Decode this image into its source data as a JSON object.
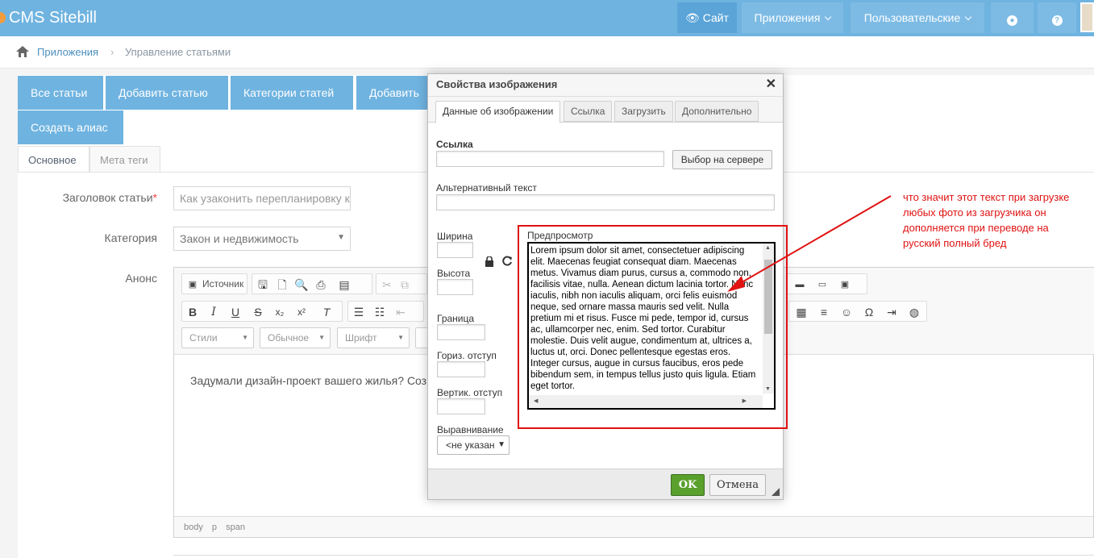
{
  "app": {
    "title": "CMS Sitebill"
  },
  "topbar": {
    "site_label": "Сайт",
    "apps_label": "Приложения",
    "user_label": "Пользовательские",
    "globe_icon": "globe-icon",
    "help_label": "?"
  },
  "breadcrumb": {
    "items": [
      "Приложения",
      "Управление статьями"
    ],
    "separator": "›"
  },
  "actions": [
    "Все статьи",
    "Добавить статью",
    "Категории статей",
    "Добавить",
    "Создать алиас"
  ],
  "form_tabs": [
    "Основное",
    "Мета теги"
  ],
  "form": {
    "title_label": "Заголовок статьи",
    "required_mark": "*",
    "title_value": "Как узаконить перепланировку к",
    "category_label": "Категория",
    "category_value": "Закон и недвижимость",
    "announce_label": "Анонс"
  },
  "editor": {
    "source_label": "Источник",
    "styles_label": "Стили",
    "format_label": "Обычное",
    "font_label": "Шрифт",
    "body_text": "Задумали дизайн-проект вашего жилья? Соз",
    "path": [
      "body",
      "p",
      "span"
    ]
  },
  "dialog": {
    "title": "Свойства изображения",
    "close": "✕",
    "tabs": [
      "Данные об изображении",
      "Ссылка",
      "Загрузить",
      "Дополнительно"
    ],
    "url_label": "Ссылка",
    "browse_button": "Выбор на сервере",
    "alt_label": "Альтернативный текст",
    "width_label": "Ширина",
    "height_label": "Высота",
    "border_label": "Граница",
    "hspace_label": "Гориз. отступ",
    "vspace_label": "Вертик. отступ",
    "align_label": "Выравнивание",
    "align_value": "<не указан",
    "preview_label": "Предпросмотр",
    "preview_text": "Lorem ipsum dolor sit amet, consectetuer adipiscing elit. Maecenas feugiat consequat diam. Maecenas metus. Vivamus diam purus, cursus a, commodo non, facilisis vitae, nulla. Aenean dictum lacinia tortor. Nunc iaculis, nibh non iaculis aliquam, orci felis euismod neque, sed ornare massa mauris sed velit. Nulla pretium mi et risus. Fusce mi pede, tempor id, cursus ac, ullamcorper nec, enim. Sed tortor. Curabitur molestie. Duis velit augue, condimentum at, ultrices a, luctus ut, orci. Donec pellentesque egestas eros. Integer cursus, augue in cursus faucibus, eros pede bibendum sem, in tempus tellus justo quis ligula. Etiam eget tortor.",
    "ok_button": "OK",
    "cancel_button": "Отмена"
  },
  "annotation": {
    "text": "что значит этот текст при загрузке любых фото из загрузчика он дополняется при переводе на русский полный бред",
    "color": "#e01212"
  },
  "colors": {
    "primary": "#6fb3e0",
    "ok": "#5aa02c",
    "annotation": "#e01212"
  }
}
